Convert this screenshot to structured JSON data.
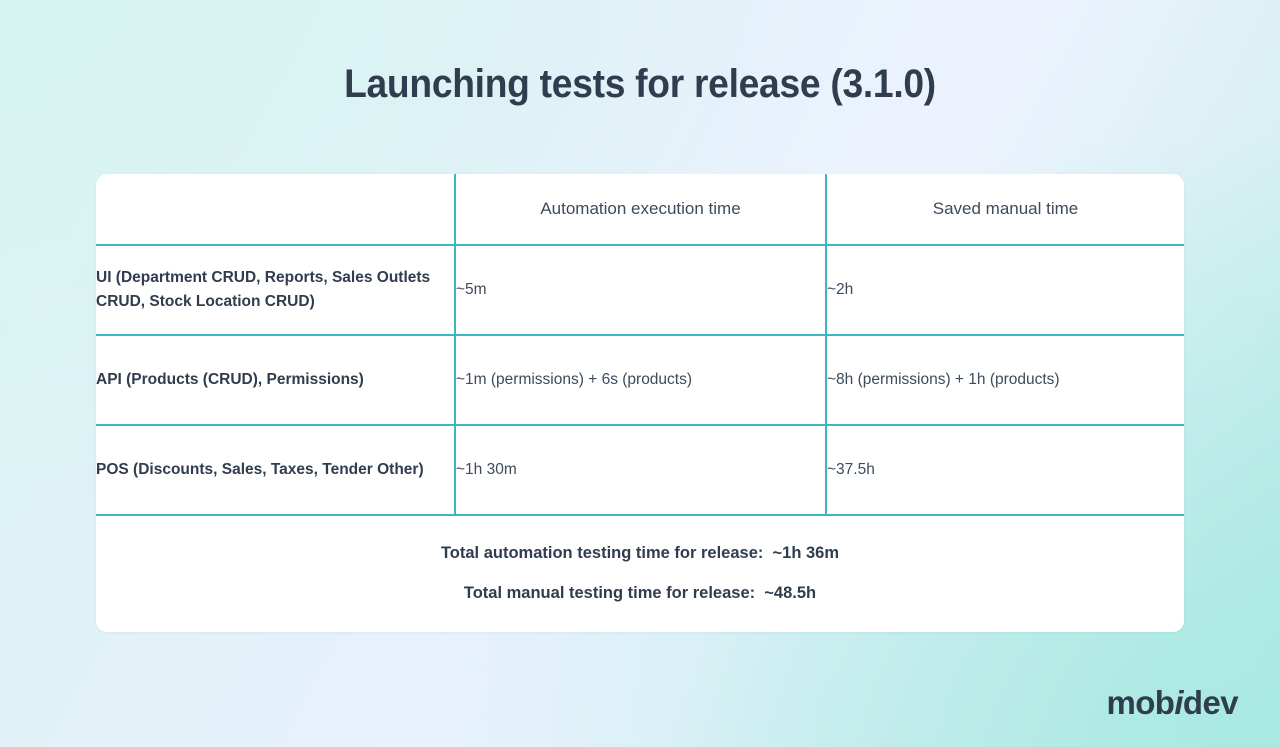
{
  "page": {
    "title": "Launching tests for release (3.1.0)",
    "background_from": "#d9f3f1",
    "background_mid": "#edf3fe",
    "background_to": "#b3eae3",
    "accent_color": "#3fb5c2",
    "text_color": "#2f3d4e",
    "card_color": "#ffffff"
  },
  "table": {
    "headers": {
      "col1": "",
      "col2": "Automation execution time",
      "col3": "Saved manual time"
    },
    "rows": [
      {
        "scope": "UI (Department CRUD, Reports, Sales Outlets CRUD, Stock Location CRUD)",
        "automation": "~5m",
        "saved": "~2h"
      },
      {
        "scope": "API (Products (CRUD), Permissions)",
        "automation": "~1m (permissions) + 6s (products)",
        "saved": "~8h (permissions) + 1h (products)"
      },
      {
        "scope": "POS (Discounts, Sales, Taxes, Tender Other)",
        "automation": "~1h 30m",
        "saved": "~37.5h"
      }
    ]
  },
  "totals": {
    "automation": "Total automation testing time for release:  ~1h 36m",
    "manual": "Total manual testing time for release:  ~48.5h"
  },
  "logo": {
    "part1": "mob",
    "part_i": "i",
    "part2": "dev"
  }
}
